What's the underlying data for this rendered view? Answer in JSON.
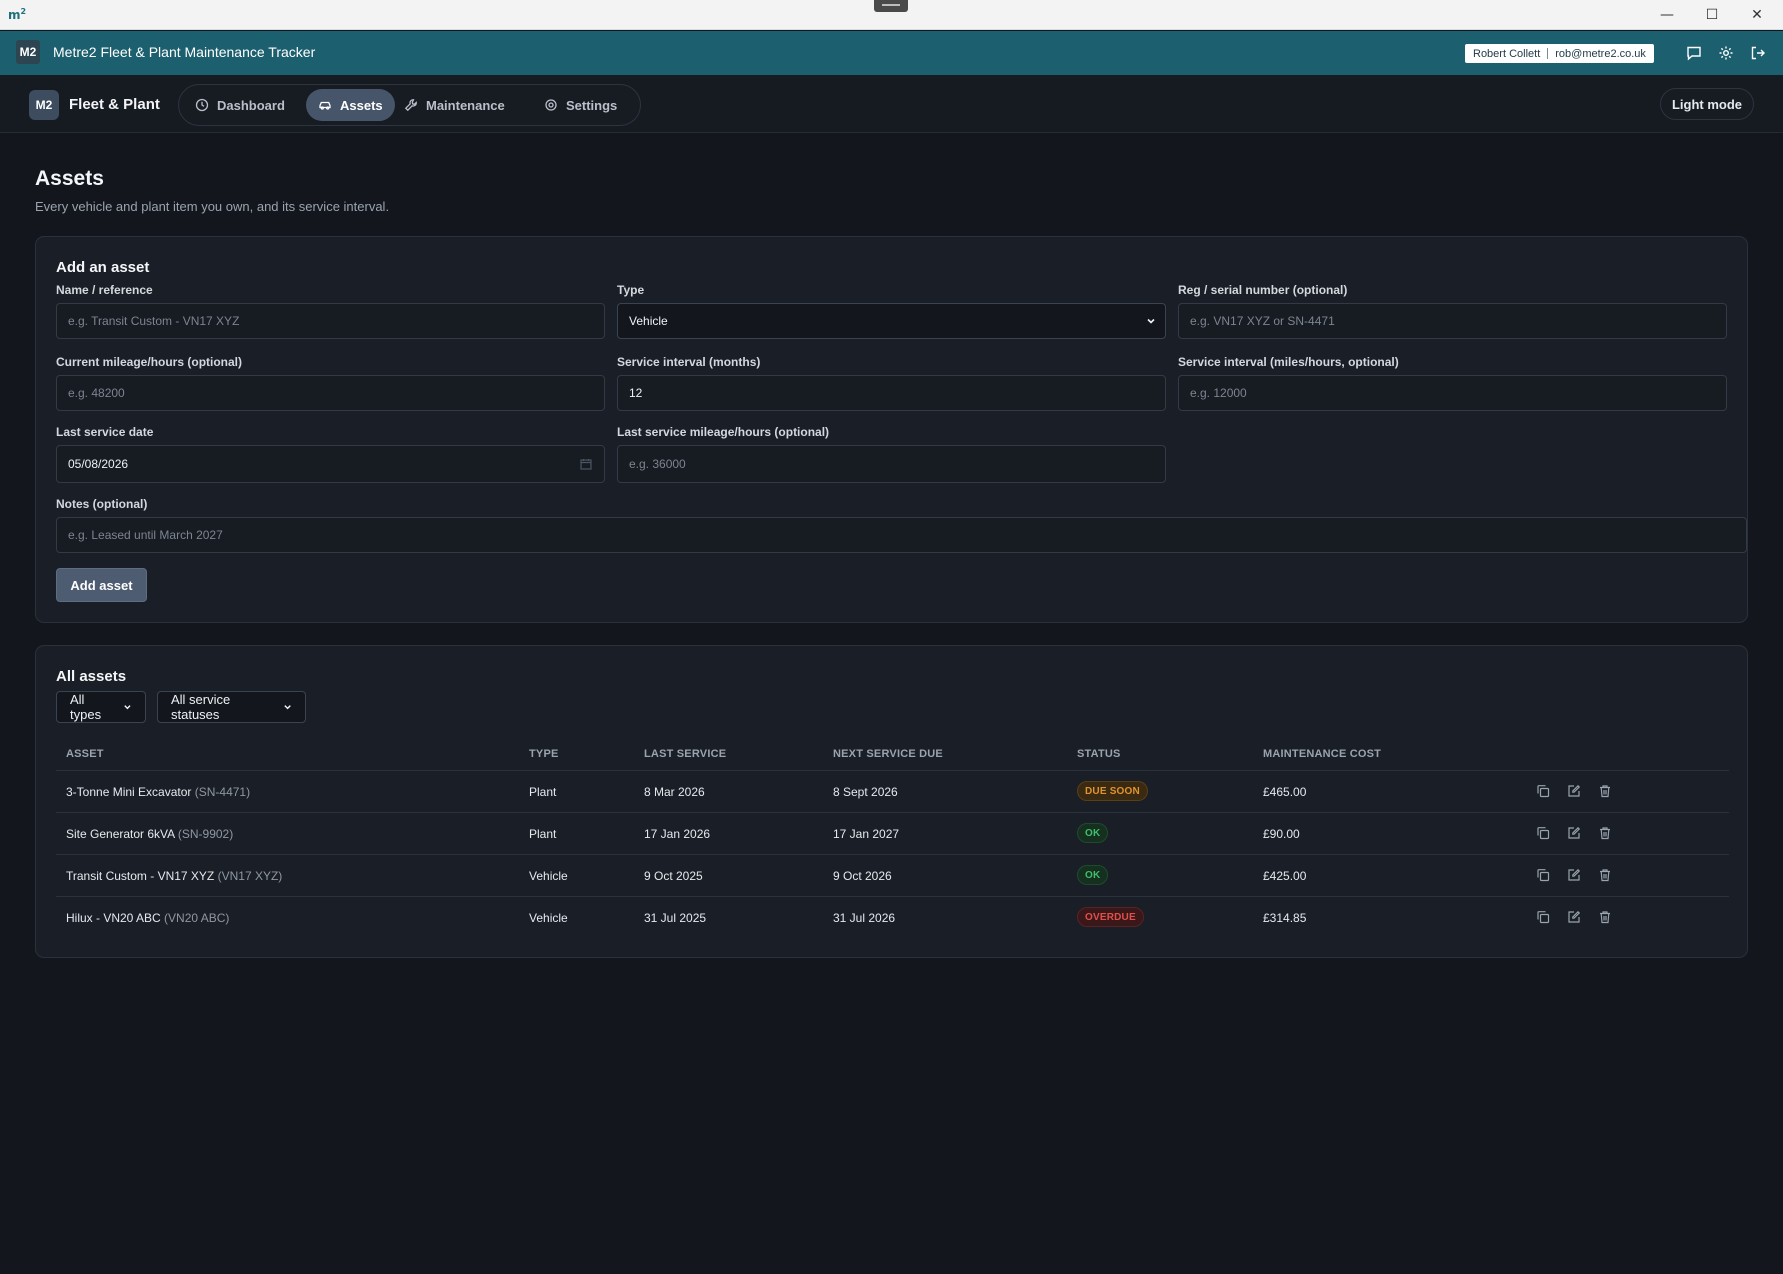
{
  "os": {
    "logo": "m",
    "logo_sup": "2",
    "min": "—",
    "max": "☐",
    "close": "✕"
  },
  "header": {
    "mark": "M2",
    "title": "Metre2 Fleet & Plant Maintenance Tracker",
    "user_name": "Robert Collett",
    "user_email": "rob@metre2.co.uk"
  },
  "nav": {
    "brand_mark": "M2",
    "brand_name": "Fleet & Plant",
    "items": [
      {
        "label": "Dashboard",
        "icon": "clock-icon"
      },
      {
        "label": "Assets",
        "icon": "car-icon",
        "active": true
      },
      {
        "label": "Maintenance",
        "icon": "wrench-icon"
      },
      {
        "label": "Settings",
        "icon": "gear-icon"
      }
    ],
    "theme_toggle": "Light mode"
  },
  "page": {
    "title": "Assets",
    "subtitle": "Every vehicle and plant item you own, and its service interval."
  },
  "form": {
    "title": "Add an asset",
    "name": {
      "label": "Name / reference",
      "placeholder": "e.g. Transit Custom - VN17 XYZ"
    },
    "type": {
      "label": "Type",
      "value": "Vehicle"
    },
    "reg": {
      "label": "Reg / serial number (optional)",
      "placeholder": "e.g. VN17 XYZ or SN-4471"
    },
    "mileage": {
      "label": "Current mileage/hours (optional)",
      "placeholder": "e.g. 48200"
    },
    "interval_months": {
      "label": "Service interval (months)",
      "value": "12"
    },
    "interval_miles": {
      "label": "Service interval (miles/hours, optional)",
      "placeholder": "e.g. 12000"
    },
    "last_date": {
      "label": "Last service date",
      "value": "05/08/2026"
    },
    "last_mileage": {
      "label": "Last service mileage/hours (optional)",
      "placeholder": "e.g. 36000"
    },
    "notes": {
      "label": "Notes (optional)",
      "placeholder": "e.g. Leased until March 2027"
    },
    "submit": "Add asset"
  },
  "list": {
    "title": "All assets",
    "filter_type": "All types",
    "filter_status": "All service statuses",
    "columns": [
      "ASSET",
      "TYPE",
      "LAST SERVICE",
      "NEXT SERVICE DUE",
      "STATUS",
      "MAINTENANCE COST"
    ],
    "rows": [
      {
        "name": "3-Tonne Mini Excavator",
        "serial": "(SN-4471)",
        "type": "Plant",
        "last": "8 Mar 2026",
        "next": "8 Sept 2026",
        "status": "DUE SOON",
        "cost": "£465.00"
      },
      {
        "name": "Site Generator 6kVA",
        "serial": "(SN-9902)",
        "type": "Plant",
        "last": "17 Jan 2026",
        "next": "17 Jan 2027",
        "status": "OK",
        "cost": "£90.00"
      },
      {
        "name": "Transit Custom - VN17 XYZ",
        "serial": "(VN17 XYZ)",
        "type": "Vehicle",
        "last": "9 Oct 2025",
        "next": "9 Oct 2026",
        "status": "OK",
        "cost": "£425.00"
      },
      {
        "name": "Hilux - VN20 ABC",
        "serial": "(VN20 ABC)",
        "type": "Vehicle",
        "last": "31 Jul 2025",
        "next": "31 Jul 2026",
        "status": "OVERDUE",
        "cost": "£314.85"
      }
    ]
  },
  "colors": {
    "header_bg": "#1c5f6e",
    "page_bg": "#13171d",
    "card_bg": "#1a1f27",
    "accent": "#465569",
    "status_due_soon": "#e0932e",
    "status_ok": "#3fbf6a",
    "status_overdue": "#e0504a"
  }
}
